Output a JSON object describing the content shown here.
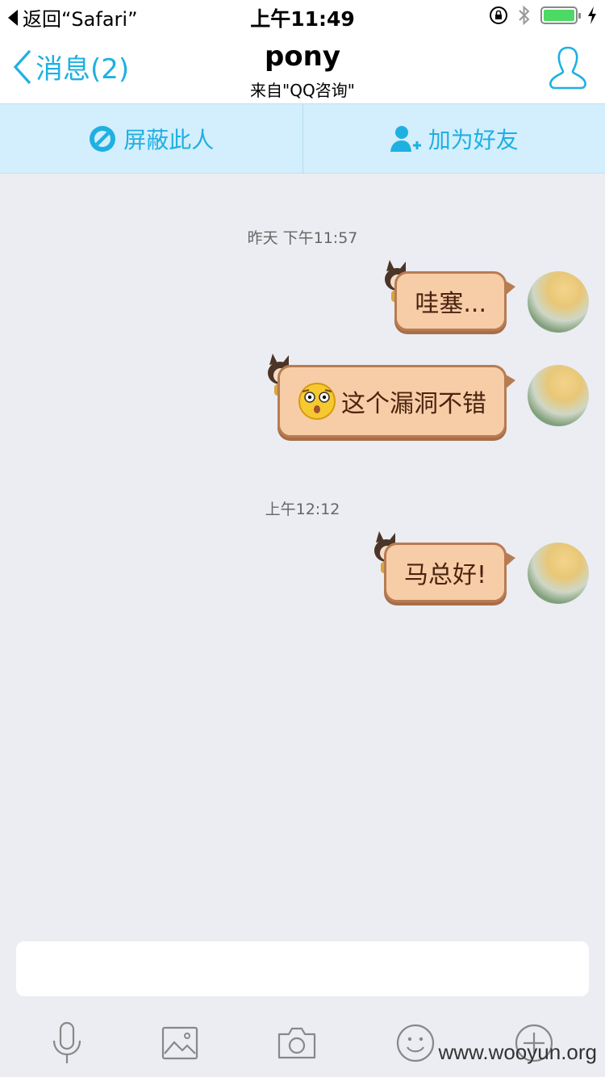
{
  "status_bar": {
    "back_app_label": "返回“Safari”",
    "time": "上午11:49"
  },
  "nav": {
    "back_label": "消息(2)",
    "title": "pony",
    "subtitle": "来自\"QQ咨询\""
  },
  "actions": {
    "block_label": "屏蔽此人",
    "add_friend_label": "加为好友"
  },
  "messages": [
    {
      "timestamp": "昨天 下午11:57"
    },
    {
      "text": "哇塞..."
    },
    {
      "text": "这个漏洞不错",
      "emoji": "shocked-face-emoji"
    },
    {
      "timestamp": "上午12:12"
    },
    {
      "text": "马总好!"
    }
  ],
  "input": {
    "placeholder": ""
  },
  "toolbar_icons": [
    "microphone-icon",
    "image-icon",
    "camera-icon",
    "emoji-icon",
    "plus-icon"
  ],
  "watermark": "www.wooyun.org",
  "colors": {
    "accent": "#1fb0e2",
    "action_bar_bg": "#d3eefc",
    "bubble_bg": "#f7cda7",
    "bubble_border": "#b87c52",
    "chat_bg": "#ebedf2"
  }
}
